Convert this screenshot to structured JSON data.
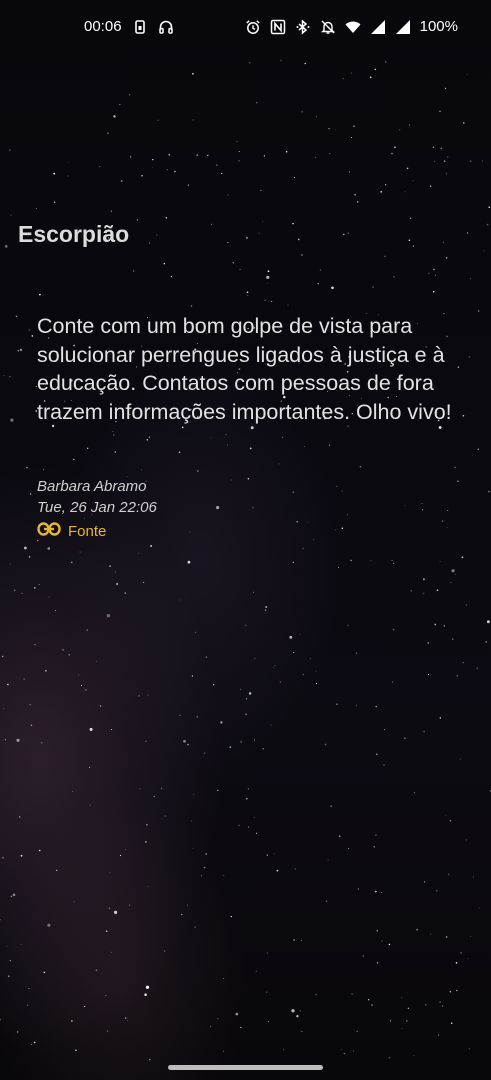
{
  "status_bar": {
    "time": "00:06",
    "battery": "100%",
    "left_icons": [
      "sim-card-icon",
      "headphones-icon"
    ],
    "right_icons": [
      "alarm-icon",
      "nfc-icon",
      "bluetooth-icon",
      "bell-off-icon",
      "wifi-icon",
      "signal-icon",
      "signal-icon"
    ]
  },
  "sign": {
    "title": "Escorpião"
  },
  "horoscope": {
    "text": "Conte com um bom golpe de vista para solucionar perrengues ligados à justiça e à educação. Contatos com pessoas de fora trazem informações importantes. Olho vivo!",
    "author": "Barbara Abramo",
    "date": "Tue, 26 Jan 22:06",
    "source_label": "Fonte",
    "source_icon": "link-icon"
  },
  "colors": {
    "background": "#050409",
    "text": "#e2e2e2",
    "accent": "#e5b43a"
  }
}
